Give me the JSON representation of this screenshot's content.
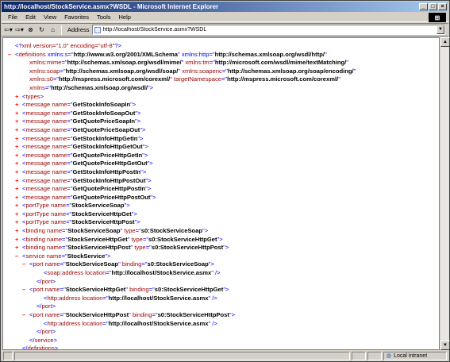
{
  "window": {
    "title": "http://localhost/StockService.asmx?WSDL - Microsoft Internet Explorer"
  },
  "menu": [
    "File",
    "Edit",
    "View",
    "Favorites",
    "Tools",
    "Help"
  ],
  "toolbar": {
    "address_label": "Address",
    "address_value": "http://localhost/StockService.asmx?WSDL"
  },
  "status": {
    "zone": "Local intranet"
  },
  "xml_lines": [
    {
      "indent": 0,
      "pm": "",
      "parts": [
        [
          "blue",
          "<?"
        ],
        [
          "red",
          "xml version=\"1.0\" encoding=\"utf-8\""
        ],
        [
          "blue",
          "?>"
        ]
      ]
    },
    {
      "indent": 0,
      "pm": "–",
      "parts": [
        [
          "blue",
          "<"
        ],
        [
          "red",
          "definitions"
        ],
        [
          "blue",
          " xmlns:s"
        ],
        [
          "blue",
          "=\""
        ],
        [
          "val",
          "http://www.w3.org/2001/XMLSchema"
        ],
        [
          "blue",
          "\""
        ],
        [
          "blue",
          " xmlns:http"
        ],
        [
          "blue",
          "=\""
        ],
        [
          "val",
          "http://schemas.xmlsoap.org/wsdl/http/"
        ],
        [
          "blue",
          "\""
        ]
      ]
    },
    {
      "indent": 2,
      "pm": "",
      "parts": [
        [
          "attr",
          "xmlns:mime"
        ],
        [
          "blue",
          "=\""
        ],
        [
          "val",
          "http://schemas.xmlsoap.org/wsdl/mime/"
        ],
        [
          "blue",
          "\""
        ],
        [
          "attr",
          " xmlns:tm"
        ],
        [
          "blue",
          "=\""
        ],
        [
          "val",
          "http://microsoft.com/wsdl/mime/textMatching/"
        ],
        [
          "blue",
          "\""
        ]
      ]
    },
    {
      "indent": 2,
      "pm": "",
      "parts": [
        [
          "attr",
          "xmlns:soap"
        ],
        [
          "blue",
          "=\""
        ],
        [
          "val",
          "http://schemas.xmlsoap.org/wsdl/soap/"
        ],
        [
          "blue",
          "\""
        ],
        [
          "attr",
          " xmlns:soapenc"
        ],
        [
          "blue",
          "=\""
        ],
        [
          "val",
          "http://schemas.xmlsoap.org/soap/encoding/"
        ],
        [
          "blue",
          "\""
        ]
      ]
    },
    {
      "indent": 2,
      "pm": "",
      "parts": [
        [
          "attr",
          "xmlns:s0"
        ],
        [
          "blue",
          "=\""
        ],
        [
          "val",
          "http://mspress.microsoft.com/corexml/"
        ],
        [
          "blue",
          "\""
        ],
        [
          "attr",
          " targetNamespace"
        ],
        [
          "blue",
          "=\""
        ],
        [
          "val",
          "http://mspress.microsoft.com/corexml/"
        ],
        [
          "blue",
          "\""
        ]
      ]
    },
    {
      "indent": 2,
      "pm": "",
      "parts": [
        [
          "attr",
          "xmlns"
        ],
        [
          "blue",
          "=\""
        ],
        [
          "val",
          "http://schemas.xmlsoap.org/wsdl/"
        ],
        [
          "blue",
          "\">"
        ]
      ]
    },
    {
      "indent": 1,
      "pm": "+",
      "parts": [
        [
          "blue",
          "<"
        ],
        [
          "red",
          "types"
        ],
        [
          "blue",
          ">"
        ]
      ]
    },
    {
      "indent": 1,
      "pm": "+",
      "parts": [
        [
          "blue",
          "<"
        ],
        [
          "red",
          "message"
        ],
        [
          "attr",
          " name"
        ],
        [
          "blue",
          "=\""
        ],
        [
          "val",
          "GetStockInfoSoapIn"
        ],
        [
          "blue",
          "\">"
        ]
      ]
    },
    {
      "indent": 1,
      "pm": "+",
      "parts": [
        [
          "blue",
          "<"
        ],
        [
          "red",
          "message"
        ],
        [
          "attr",
          " name"
        ],
        [
          "blue",
          "=\""
        ],
        [
          "val",
          "GetStockInfoSoapOut"
        ],
        [
          "blue",
          "\">"
        ]
      ]
    },
    {
      "indent": 1,
      "pm": "+",
      "parts": [
        [
          "blue",
          "<"
        ],
        [
          "red",
          "message"
        ],
        [
          "attr",
          " name"
        ],
        [
          "blue",
          "=\""
        ],
        [
          "val",
          "GetQuotePriceSoapIn"
        ],
        [
          "blue",
          "\">"
        ]
      ]
    },
    {
      "indent": 1,
      "pm": "+",
      "parts": [
        [
          "blue",
          "<"
        ],
        [
          "red",
          "message"
        ],
        [
          "attr",
          " name"
        ],
        [
          "blue",
          "=\""
        ],
        [
          "val",
          "GetQuotePriceSoapOut"
        ],
        [
          "blue",
          "\">"
        ]
      ]
    },
    {
      "indent": 1,
      "pm": "+",
      "parts": [
        [
          "blue",
          "<"
        ],
        [
          "red",
          "message"
        ],
        [
          "attr",
          " name"
        ],
        [
          "blue",
          "=\""
        ],
        [
          "val",
          "GetStockInfoHttpGetIn"
        ],
        [
          "blue",
          "\">"
        ]
      ]
    },
    {
      "indent": 1,
      "pm": "+",
      "parts": [
        [
          "blue",
          "<"
        ],
        [
          "red",
          "message"
        ],
        [
          "attr",
          " name"
        ],
        [
          "blue",
          "=\""
        ],
        [
          "val",
          "GetStockInfoHttpGetOut"
        ],
        [
          "blue",
          "\">"
        ]
      ]
    },
    {
      "indent": 1,
      "pm": "+",
      "parts": [
        [
          "blue",
          "<"
        ],
        [
          "red",
          "message"
        ],
        [
          "attr",
          " name"
        ],
        [
          "blue",
          "=\""
        ],
        [
          "val",
          "GetQuotePriceHttpGetIn"
        ],
        [
          "blue",
          "\">"
        ]
      ]
    },
    {
      "indent": 1,
      "pm": "+",
      "parts": [
        [
          "blue",
          "<"
        ],
        [
          "red",
          "message"
        ],
        [
          "attr",
          " name"
        ],
        [
          "blue",
          "=\""
        ],
        [
          "val",
          "GetQuotePriceHttpGetOut"
        ],
        [
          "blue",
          "\">"
        ]
      ]
    },
    {
      "indent": 1,
      "pm": "+",
      "parts": [
        [
          "blue",
          "<"
        ],
        [
          "red",
          "message"
        ],
        [
          "attr",
          " name"
        ],
        [
          "blue",
          "=\""
        ],
        [
          "val",
          "GetStockInfoHttpPostIn"
        ],
        [
          "blue",
          "\">"
        ]
      ]
    },
    {
      "indent": 1,
      "pm": "+",
      "parts": [
        [
          "blue",
          "<"
        ],
        [
          "red",
          "message"
        ],
        [
          "attr",
          " name"
        ],
        [
          "blue",
          "=\""
        ],
        [
          "val",
          "GetStockInfoHttpPostOut"
        ],
        [
          "blue",
          "\">"
        ]
      ]
    },
    {
      "indent": 1,
      "pm": "+",
      "parts": [
        [
          "blue",
          "<"
        ],
        [
          "red",
          "message"
        ],
        [
          "attr",
          " name"
        ],
        [
          "blue",
          "=\""
        ],
        [
          "val",
          "GetQuotePriceHttpPostIn"
        ],
        [
          "blue",
          "\">"
        ]
      ]
    },
    {
      "indent": 1,
      "pm": "+",
      "parts": [
        [
          "blue",
          "<"
        ],
        [
          "red",
          "message"
        ],
        [
          "attr",
          " name"
        ],
        [
          "blue",
          "=\""
        ],
        [
          "val",
          "GetQuotePriceHttpPostOut"
        ],
        [
          "blue",
          "\">"
        ]
      ]
    },
    {
      "indent": 1,
      "pm": "+",
      "parts": [
        [
          "blue",
          "<"
        ],
        [
          "red",
          "portType"
        ],
        [
          "attr",
          " name"
        ],
        [
          "blue",
          "=\""
        ],
        [
          "val",
          "StockServiceSoap"
        ],
        [
          "blue",
          "\">"
        ]
      ]
    },
    {
      "indent": 1,
      "pm": "+",
      "parts": [
        [
          "blue",
          "<"
        ],
        [
          "red",
          "portType"
        ],
        [
          "attr",
          " name"
        ],
        [
          "blue",
          "=\""
        ],
        [
          "val",
          "StockServiceHttpGet"
        ],
        [
          "blue",
          "\">"
        ]
      ]
    },
    {
      "indent": 1,
      "pm": "+",
      "parts": [
        [
          "blue",
          "<"
        ],
        [
          "red",
          "portType"
        ],
        [
          "attr",
          " name"
        ],
        [
          "blue",
          "=\""
        ],
        [
          "val",
          "StockServiceHttpPost"
        ],
        [
          "blue",
          "\">"
        ]
      ]
    },
    {
      "indent": 1,
      "pm": "+",
      "parts": [
        [
          "blue",
          "<"
        ],
        [
          "red",
          "binding"
        ],
        [
          "attr",
          " name"
        ],
        [
          "blue",
          "=\""
        ],
        [
          "val",
          "StockServiceSoap"
        ],
        [
          "blue",
          "\""
        ],
        [
          "attr",
          " type"
        ],
        [
          "blue",
          "=\""
        ],
        [
          "val",
          "s0:StockServiceSoap"
        ],
        [
          "blue",
          "\">"
        ]
      ]
    },
    {
      "indent": 1,
      "pm": "+",
      "parts": [
        [
          "blue",
          "<"
        ],
        [
          "red",
          "binding"
        ],
        [
          "attr",
          " name"
        ],
        [
          "blue",
          "=\""
        ],
        [
          "val",
          "StockServiceHttpGet"
        ],
        [
          "blue",
          "\""
        ],
        [
          "attr",
          " type"
        ],
        [
          "blue",
          "=\""
        ],
        [
          "val",
          "s0:StockServiceHttpGet"
        ],
        [
          "blue",
          "\">"
        ]
      ]
    },
    {
      "indent": 1,
      "pm": "+",
      "parts": [
        [
          "blue",
          "<"
        ],
        [
          "red",
          "binding"
        ],
        [
          "attr",
          " name"
        ],
        [
          "blue",
          "=\""
        ],
        [
          "val",
          "StockServiceHttpPost"
        ],
        [
          "blue",
          "\""
        ],
        [
          "attr",
          " type"
        ],
        [
          "blue",
          "=\""
        ],
        [
          "val",
          "s0:StockServiceHttpPost"
        ],
        [
          "blue",
          "\">"
        ]
      ]
    },
    {
      "indent": 1,
      "pm": "–",
      "parts": [
        [
          "blue",
          "<"
        ],
        [
          "red",
          "service"
        ],
        [
          "attr",
          " name"
        ],
        [
          "blue",
          "=\""
        ],
        [
          "val",
          "StockService"
        ],
        [
          "blue",
          "\">"
        ]
      ]
    },
    {
      "indent": 2,
      "pm": "–",
      "parts": [
        [
          "blue",
          "<"
        ],
        [
          "red",
          "port"
        ],
        [
          "attr",
          " name"
        ],
        [
          "blue",
          "=\""
        ],
        [
          "val",
          "StockServiceSoap"
        ],
        [
          "blue",
          "\""
        ],
        [
          "attr",
          " binding"
        ],
        [
          "blue",
          "=\""
        ],
        [
          "val",
          "s0:StockServiceSoap"
        ],
        [
          "blue",
          "\">"
        ]
      ]
    },
    {
      "indent": 4,
      "pm": "",
      "parts": [
        [
          "blue",
          "<"
        ],
        [
          "red",
          "soap:address"
        ],
        [
          "attr",
          " location"
        ],
        [
          "blue",
          "=\""
        ],
        [
          "val",
          "http://localhost/StockService.asmx"
        ],
        [
          "blue",
          "\" />"
        ]
      ]
    },
    {
      "indent": 3,
      "pm": "",
      "parts": [
        [
          "blue",
          "</"
        ],
        [
          "red",
          "port"
        ],
        [
          "blue",
          ">"
        ]
      ]
    },
    {
      "indent": 2,
      "pm": "–",
      "parts": [
        [
          "blue",
          "<"
        ],
        [
          "red",
          "port"
        ],
        [
          "attr",
          " name"
        ],
        [
          "blue",
          "=\""
        ],
        [
          "val",
          "StockServiceHttpGet"
        ],
        [
          "blue",
          "\""
        ],
        [
          "attr",
          " binding"
        ],
        [
          "blue",
          "=\""
        ],
        [
          "val",
          "s0:StockServiceHttpGet"
        ],
        [
          "blue",
          "\">"
        ]
      ]
    },
    {
      "indent": 4,
      "pm": "",
      "parts": [
        [
          "blue",
          "<"
        ],
        [
          "red",
          "http:address"
        ],
        [
          "attr",
          " location"
        ],
        [
          "blue",
          "=\""
        ],
        [
          "val",
          "http://localhost/StockService.asmx"
        ],
        [
          "blue",
          "\" />"
        ]
      ]
    },
    {
      "indent": 3,
      "pm": "",
      "parts": [
        [
          "blue",
          "</"
        ],
        [
          "red",
          "port"
        ],
        [
          "blue",
          ">"
        ]
      ]
    },
    {
      "indent": 2,
      "pm": "–",
      "parts": [
        [
          "blue",
          "<"
        ],
        [
          "red",
          "port"
        ],
        [
          "attr",
          " name"
        ],
        [
          "blue",
          "=\""
        ],
        [
          "val",
          "StockServiceHttpPost"
        ],
        [
          "blue",
          "\""
        ],
        [
          "attr",
          " binding"
        ],
        [
          "blue",
          "=\""
        ],
        [
          "val",
          "s0:StockServiceHttpPost"
        ],
        [
          "blue",
          "\">"
        ]
      ]
    },
    {
      "indent": 4,
      "pm": "",
      "parts": [
        [
          "blue",
          "<"
        ],
        [
          "red",
          "http:address"
        ],
        [
          "attr",
          " location"
        ],
        [
          "blue",
          "=\""
        ],
        [
          "val",
          "http://localhost/StockService.asmx"
        ],
        [
          "blue",
          "\" />"
        ]
      ]
    },
    {
      "indent": 3,
      "pm": "",
      "parts": [
        [
          "blue",
          "</"
        ],
        [
          "red",
          "port"
        ],
        [
          "blue",
          ">"
        ]
      ]
    },
    {
      "indent": 2,
      "pm": "",
      "parts": [
        [
          "blue",
          "</"
        ],
        [
          "red",
          "service"
        ],
        [
          "blue",
          ">"
        ]
      ]
    },
    {
      "indent": 1,
      "pm": "",
      "parts": [
        [
          "blue",
          "</"
        ],
        [
          "red",
          "definitions"
        ],
        [
          "blue",
          ">"
        ]
      ]
    }
  ]
}
